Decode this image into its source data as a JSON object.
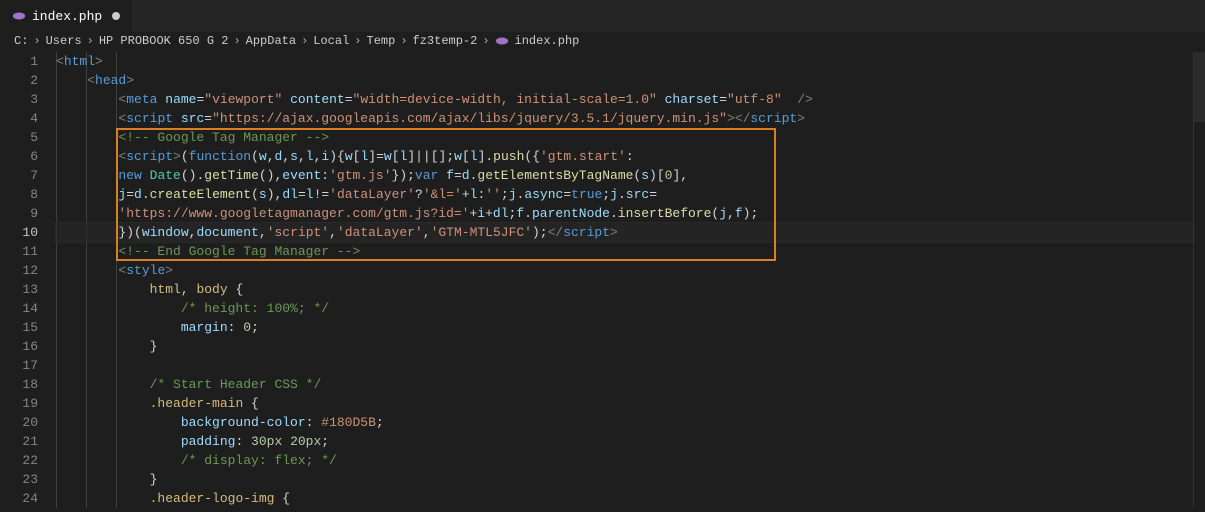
{
  "tab": {
    "filename": "index.php",
    "modified": true
  },
  "breadcrumbs": [
    "C:",
    "Users",
    "HP PROBOOK 650 G 2",
    "AppData",
    "Local",
    "Temp",
    "fz3temp-2",
    "index.php"
  ],
  "active_line": 10,
  "line_count": 24,
  "code_lines": {
    "l1": "<html>",
    "l2": "    <head>",
    "l3_a": "<meta",
    "l3_b": "name",
    "l3_c": "\"viewport\"",
    "l3_d": "content",
    "l3_e": "\"width=device-width, initial-scale=1.0\"",
    "l3_f": "charset",
    "l3_g": "\"utf-8\"",
    "l3_h": "/>",
    "l4_a": "<script",
    "l4_b": "src",
    "l4_c": "\"https://ajax.googleapis.com/ajax/libs/jquery/3.5.1/jquery.min.js\"",
    "l4_d": "></",
    "l4_e": "script",
    "l4_f": ">",
    "l5": "<!-- Google Tag Manager -->",
    "l6_a": "<script>",
    "l6_b": "(",
    "l6_c": "function",
    "l6_d": "(",
    "l6_e": "w",
    "l6_f": ",",
    "l6_g": "d",
    "l6_h": ",",
    "l6_i": "s",
    "l6_j": ",",
    "l6_k": "l",
    "l6_l": ",",
    "l6_m": "i",
    "l6_n": "){",
    "l6_o": "w",
    "l6_p": "[",
    "l6_q": "l",
    "l6_r": "]=",
    "l6_s": "w",
    "l6_t": "[",
    "l6_u": "l",
    "l6_v": "]||[];",
    "l6_w": "w",
    "l6_x": "[",
    "l6_y": "l",
    "l6_z": "].",
    "l6_aa": "push",
    "l6_ab": "({",
    "l6_ac": "'gtm.start'",
    "l6_ad": ":",
    "l7_a": "new",
    "l7_b": "Date",
    "l7_c": "().",
    "l7_d": "getTime",
    "l7_e": "(),",
    "l7_f": "event:",
    "l7_g": "'gtm.js'",
    "l7_h": "});",
    "l7_i": "var",
    "l7_j": "f",
    "l7_k": "=",
    "l7_l": "d",
    "l7_m": ".",
    "l7_n": "getElementsByTagName",
    "l7_o": "(",
    "l7_p": "s",
    "l7_q": ")[",
    "l7_r": "0",
    "l7_s": "],",
    "l8_a": "j",
    "l8_b": "=",
    "l8_c": "d",
    "l8_d": ".",
    "l8_e": "createElement",
    "l8_f": "(",
    "l8_g": "s",
    "l8_h": "),",
    "l8_i": "dl",
    "l8_j": "=",
    "l8_k": "l",
    "l8_l": "!=",
    "l8_m": "'dataLayer'",
    "l8_n": "?",
    "l8_o": "'&l='",
    "l8_p": "+",
    "l8_q": "l",
    "l8_r": ":",
    "l8_s": "''",
    "l8_t": ";",
    "l8_u": "j",
    "l8_v": ".",
    "l8_w": "async",
    "l8_x": "=",
    "l8_y": "true",
    "l8_z": ";",
    "l8_aa": "j",
    "l8_ab": ".",
    "l8_ac": "src",
    "l8_ad": "=",
    "l9_a": "'https://www.googletagmanager.com/gtm.js?id='",
    "l9_b": "+",
    "l9_c": "i",
    "l9_d": "+",
    "l9_e": "dl",
    "l9_f": ";",
    "l9_g": "f",
    "l9_h": ".",
    "l9_i": "parentNode",
    "l9_j": ".",
    "l9_k": "insertBefore",
    "l9_l": "(",
    "l9_m": "j",
    "l9_n": ",",
    "l9_o": "f",
    "l9_p": ");",
    "l10_a": "})(",
    "l10_b": "window",
    "l10_c": ",",
    "l10_d": "document",
    "l10_e": ",",
    "l10_f": "'script'",
    "l10_g": ",",
    "l10_h": "'dataLayer'",
    "l10_i": ",",
    "l10_j": "'GTM-MTL5JFC'",
    "l10_k": ");</",
    "l10_l": "script",
    "l10_m": ">",
    "l11": "<!-- End Google Tag Manager -->",
    "l12": "<style>",
    "l13_a": "html",
    "l13_b": ", ",
    "l13_c": "body",
    "l13_d": " {",
    "l14": "/* height: 100%; */",
    "l15_a": "margin",
    "l15_b": ": ",
    "l15_c": "0",
    "l15_d": ";",
    "l16": "}",
    "l17": "",
    "l18": "/* Start Header CSS */",
    "l19_a": ".header-main",
    "l19_b": " {",
    "l20_a": "background-color",
    "l20_b": ": ",
    "l20_c": "#180D5B",
    "l20_d": ";",
    "l21_a": "padding",
    "l21_b": ": ",
    "l21_c": "30px",
    "l21_d": " ",
    "l21_e": "20px",
    "l21_f": ";",
    "l22": "/* display: flex; */",
    "l23": "}",
    "l24_a": ".header-logo-img",
    "l24_b": " {"
  }
}
